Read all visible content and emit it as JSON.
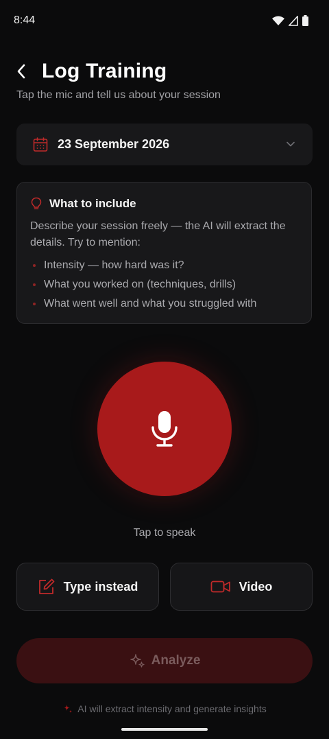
{
  "status_bar": {
    "time": "8:44"
  },
  "header": {
    "title": "Log Training",
    "subtitle": "Tap the mic and tell us about your session"
  },
  "date_picker": {
    "value": "23 September 2026"
  },
  "info_card": {
    "title": "What to include",
    "description": "Describe your session freely — the AI will extract the details. Try to mention:",
    "items": [
      "Intensity — how hard was it?",
      "What you worked on (techniques, drills)",
      "What went well and what you struggled with"
    ]
  },
  "mic": {
    "caption": "Tap to speak"
  },
  "actions": {
    "type_label": "Type instead",
    "video_label": "Video"
  },
  "analyze": {
    "label": "Analyze"
  },
  "footer": {
    "note": "AI will extract intensity and generate insights"
  },
  "colors": {
    "accent": "#a81a1b",
    "background": "#0b0b0c",
    "card": "#18181a",
    "analyze_disabled": "#3a1012"
  }
}
